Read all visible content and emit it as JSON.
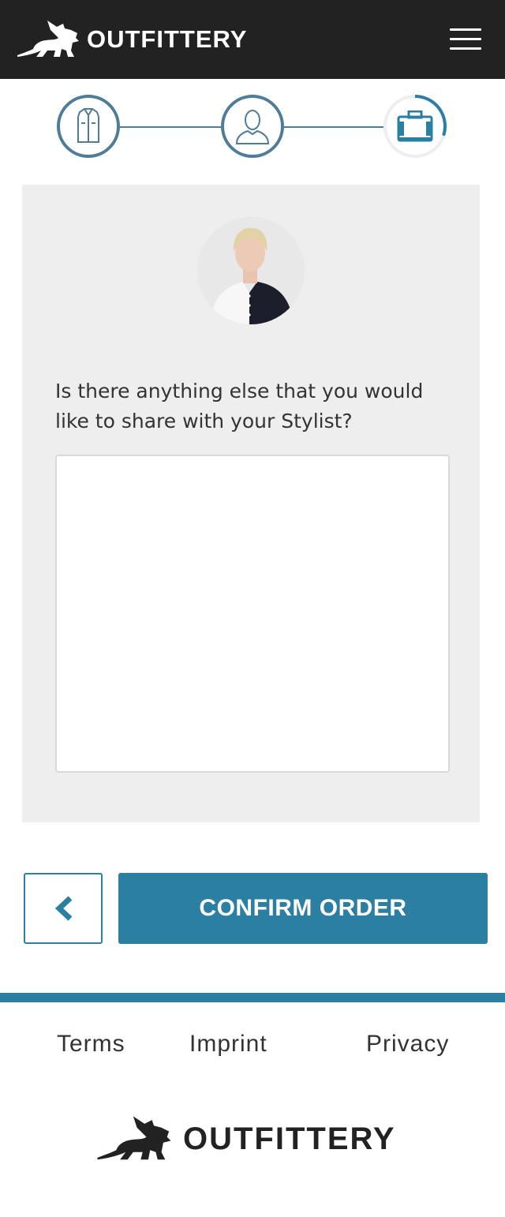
{
  "header": {
    "brand": "OUTFITTERY",
    "logo_icon": "winged-cat-logo-icon",
    "menu_icon": "hamburger-menu-icon"
  },
  "stepper": {
    "steps": [
      {
        "icon": "shirt-icon",
        "state": "completed"
      },
      {
        "icon": "person-icon",
        "state": "completed"
      },
      {
        "icon": "suitcase-icon",
        "state": "current"
      }
    ],
    "current_progress_fraction": 0.3
  },
  "form": {
    "question": "Is there anything else that you would like to share with your Stylist?",
    "notes_value": "",
    "notes_placeholder": ""
  },
  "actions": {
    "back_icon": "chevron-left-icon",
    "confirm_label": "CONFIRM ORDER"
  },
  "footer": {
    "links": [
      "Terms",
      "Imprint",
      "Privacy"
    ],
    "brand": "OUTFITTERY"
  },
  "colors": {
    "topbar": "#222222",
    "accent": "#2a7fa2",
    "step": "#4e7d99",
    "card": "#eeeeee"
  }
}
